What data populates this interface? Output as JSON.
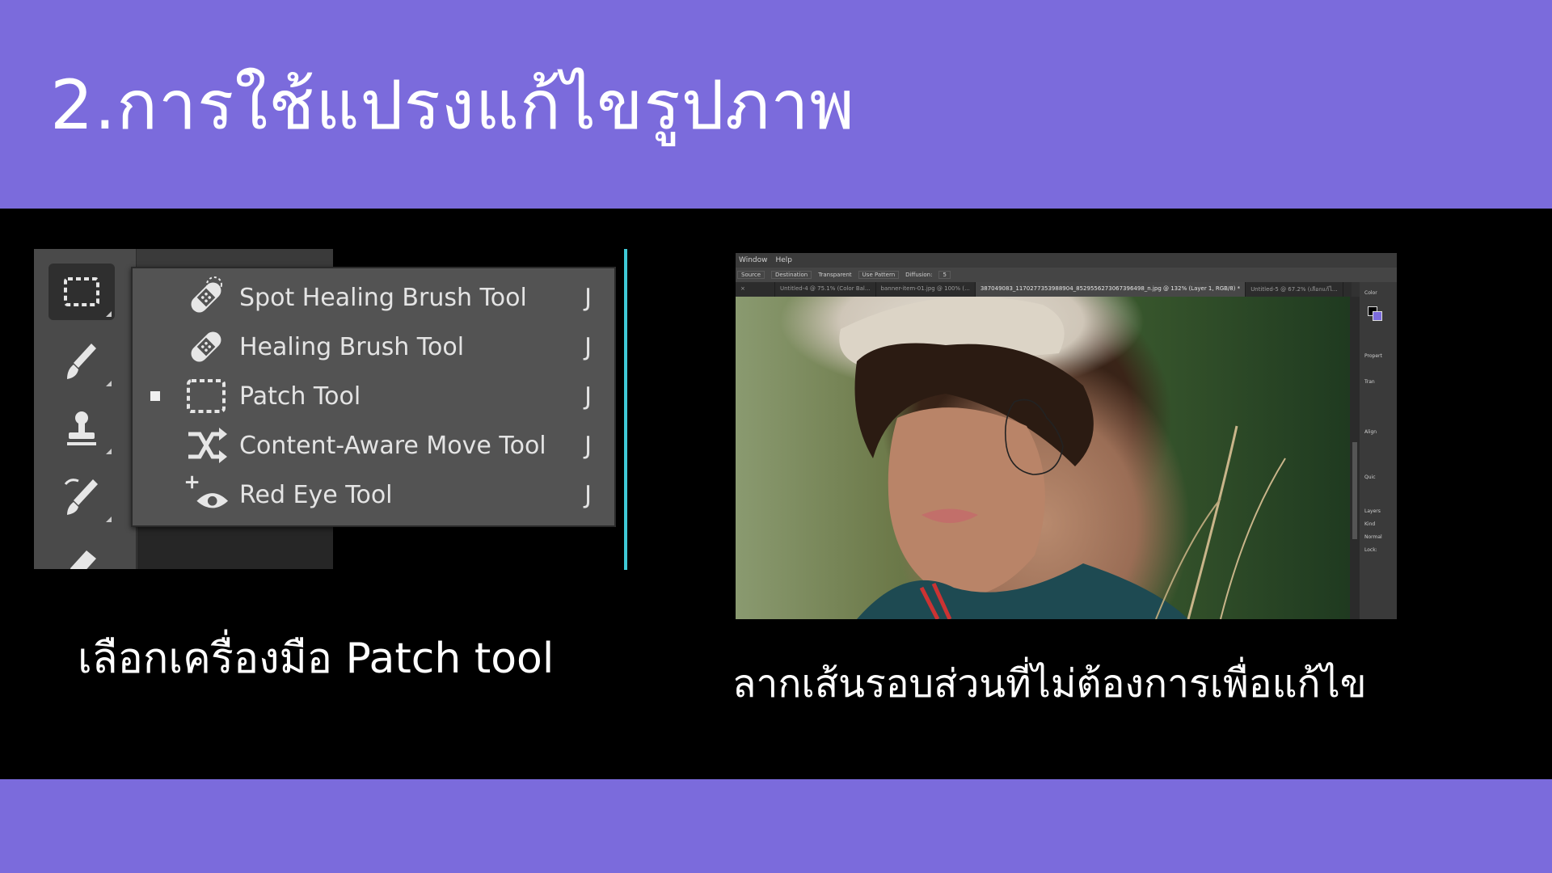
{
  "slide": {
    "title": "2.การใช้แปรงแก้ไขรูปภาพ",
    "caption_left": "เลือกเครื่องมือ Patch tool",
    "caption_right": "ลากเส้นรอบส่วนที่ไม่ต้องการเพื่อแก้ไข",
    "accent_color": "#7b6bdc",
    "divider_color": "#3fc9d6"
  },
  "flyout": {
    "items": [
      {
        "label": "Spot Healing Brush Tool",
        "shortcut": "J",
        "icon": "spot-healing-brush-icon",
        "selected": false
      },
      {
        "label": "Healing Brush Tool",
        "shortcut": "J",
        "icon": "healing-brush-icon",
        "selected": false
      },
      {
        "label": "Patch Tool",
        "shortcut": "J",
        "icon": "patch-icon",
        "selected": true
      },
      {
        "label": "Content-Aware Move Tool",
        "shortcut": "J",
        "icon": "content-aware-move-icon",
        "selected": false
      },
      {
        "label": "Red Eye Tool",
        "shortcut": "J",
        "icon": "red-eye-icon",
        "selected": false
      }
    ]
  },
  "toolbar": {
    "tools": [
      "patch-icon",
      "brush-icon",
      "stamp-icon",
      "history-brush-icon",
      "eraser-icon"
    ]
  },
  "ps_window": {
    "menu": [
      "Window",
      "Help"
    ],
    "options": [
      "Source",
      "Destination",
      "Transparent",
      "Use Pattern",
      "Diffusion:",
      "5"
    ],
    "tabs": [
      {
        "label": "Untitled-4 @ 75.1% (Color Bal...",
        "active": false
      },
      {
        "label": "banner-item-01.jpg @ 100% (...",
        "active": false
      },
      {
        "label": "387049083_1170277353988904_8529556273067396498_n.jpg @ 132% (Layer 1, RGB/8) *",
        "active": true
      },
      {
        "label": "Untitled-5 @ 67.2% (เลือกแก้ไ...",
        "active": false
      }
    ],
    "panels": [
      "Color",
      "Propert",
      "Tran",
      "Align",
      "Quic",
      "Layers",
      "Kind",
      "Normal",
      "Lock:"
    ]
  }
}
